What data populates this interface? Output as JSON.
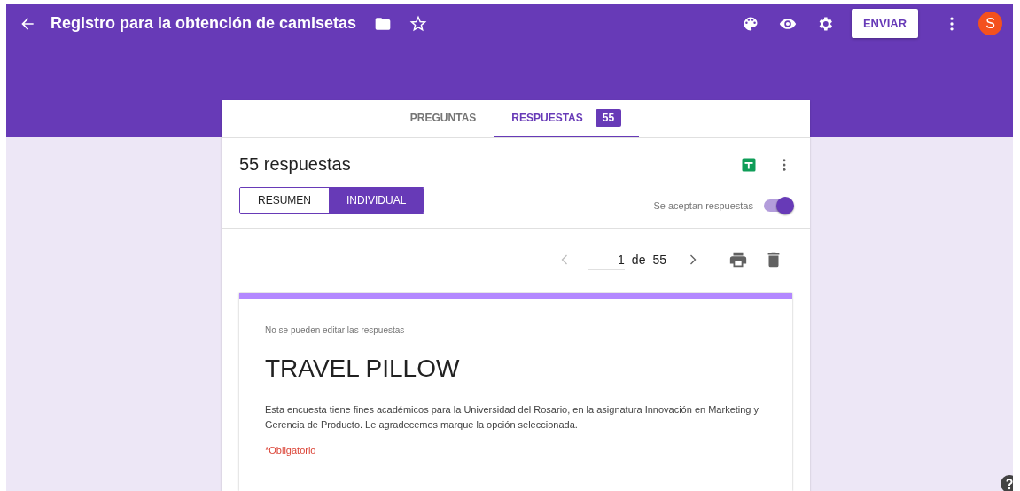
{
  "header": {
    "title": "Registro para la obtención de camisetas",
    "send_button": "ENVIAR",
    "avatar_letter": "S"
  },
  "tabs": [
    {
      "label": "PREGUNTAS",
      "selected": false
    },
    {
      "label": "RESPUESTAS",
      "selected": true,
      "badge": "55"
    }
  ],
  "responses": {
    "heading": "55 respuestas",
    "views": [
      {
        "label": "RESUMEN",
        "selected": false
      },
      {
        "label": "INDIVIDUAL",
        "selected": true
      }
    ],
    "accepting": {
      "label": "Se aceptan respuestas",
      "on": true
    }
  },
  "pager": {
    "current": "1",
    "separator": "de",
    "total": "55"
  },
  "form": {
    "note": "No se pueden editar las respuestas",
    "title": "TRAVEL PILLOW",
    "description": "Esta encuesta tiene fines académicos para la Universidad del Rosario, en la asignatura Innovación en Marketing y Gerencia de Producto. Le agradecemos marque la opción seleccionada.",
    "required": "*Obligatorio"
  }
}
